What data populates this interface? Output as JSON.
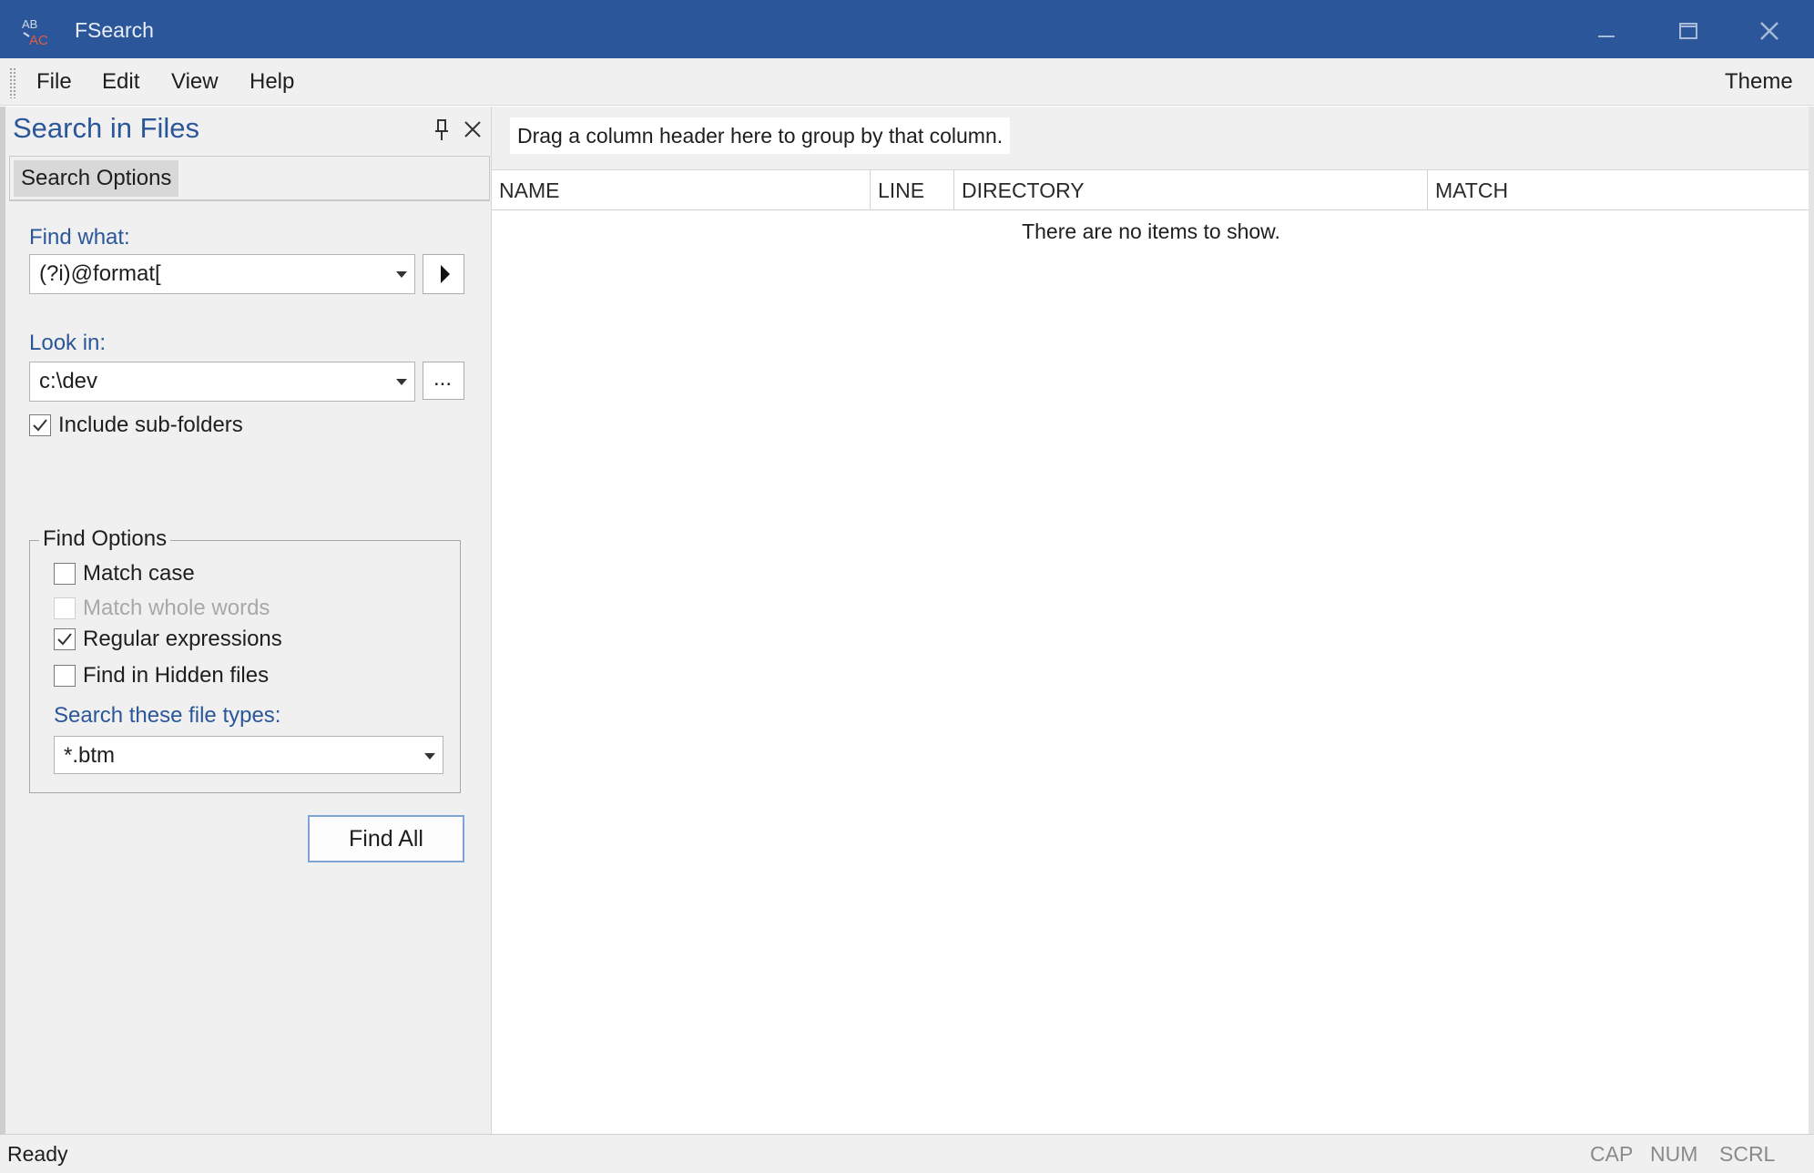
{
  "window": {
    "title": "FSearch",
    "app_icon_letters": "AB AC"
  },
  "menu": {
    "file": "File",
    "edit": "Edit",
    "view": "View",
    "help": "Help",
    "theme": "Theme"
  },
  "search_pane": {
    "title": "Search in Files",
    "tab": "Search Options",
    "find_what": {
      "label": "Find what:",
      "value": "(?i)@format["
    },
    "look_in": {
      "label": "Look in:",
      "value": "c:\\dev",
      "browse_label": "..."
    },
    "include_subfolders": {
      "label": "Include sub-folders",
      "checked": true
    },
    "find_options": {
      "legend": "Find Options",
      "match_case": {
        "label": "Match case",
        "checked": false,
        "enabled": true
      },
      "match_whole_words": {
        "label": "Match whole words",
        "checked": false,
        "enabled": false
      },
      "regular_expressions": {
        "label": "Regular expressions",
        "checked": true,
        "enabled": true
      },
      "find_hidden": {
        "label": "Find in Hidden files",
        "checked": false,
        "enabled": true
      },
      "file_types_label": "Search these file types:",
      "file_types_value": "*.btm"
    },
    "find_all_button": "Find All"
  },
  "results": {
    "group_hint": "Drag a column header here to group by that column.",
    "columns": [
      "NAME",
      "LINE",
      "DIRECTORY",
      "MATCH"
    ],
    "empty_message": "There are no items to show."
  },
  "status": {
    "text": "Ready",
    "cap": "CAP",
    "num": "NUM",
    "scrl": "SCRL"
  },
  "colors": {
    "titlebar": "#2b579a",
    "accent_text": "#2b579a",
    "panel_bg": "#f0f0f0"
  },
  "icons": [
    "app-logo-icon",
    "minimize-icon",
    "maximize-icon",
    "close-icon",
    "pin-icon",
    "pane-close-icon",
    "play-icon",
    "chevron-down-icon",
    "check-icon"
  ]
}
